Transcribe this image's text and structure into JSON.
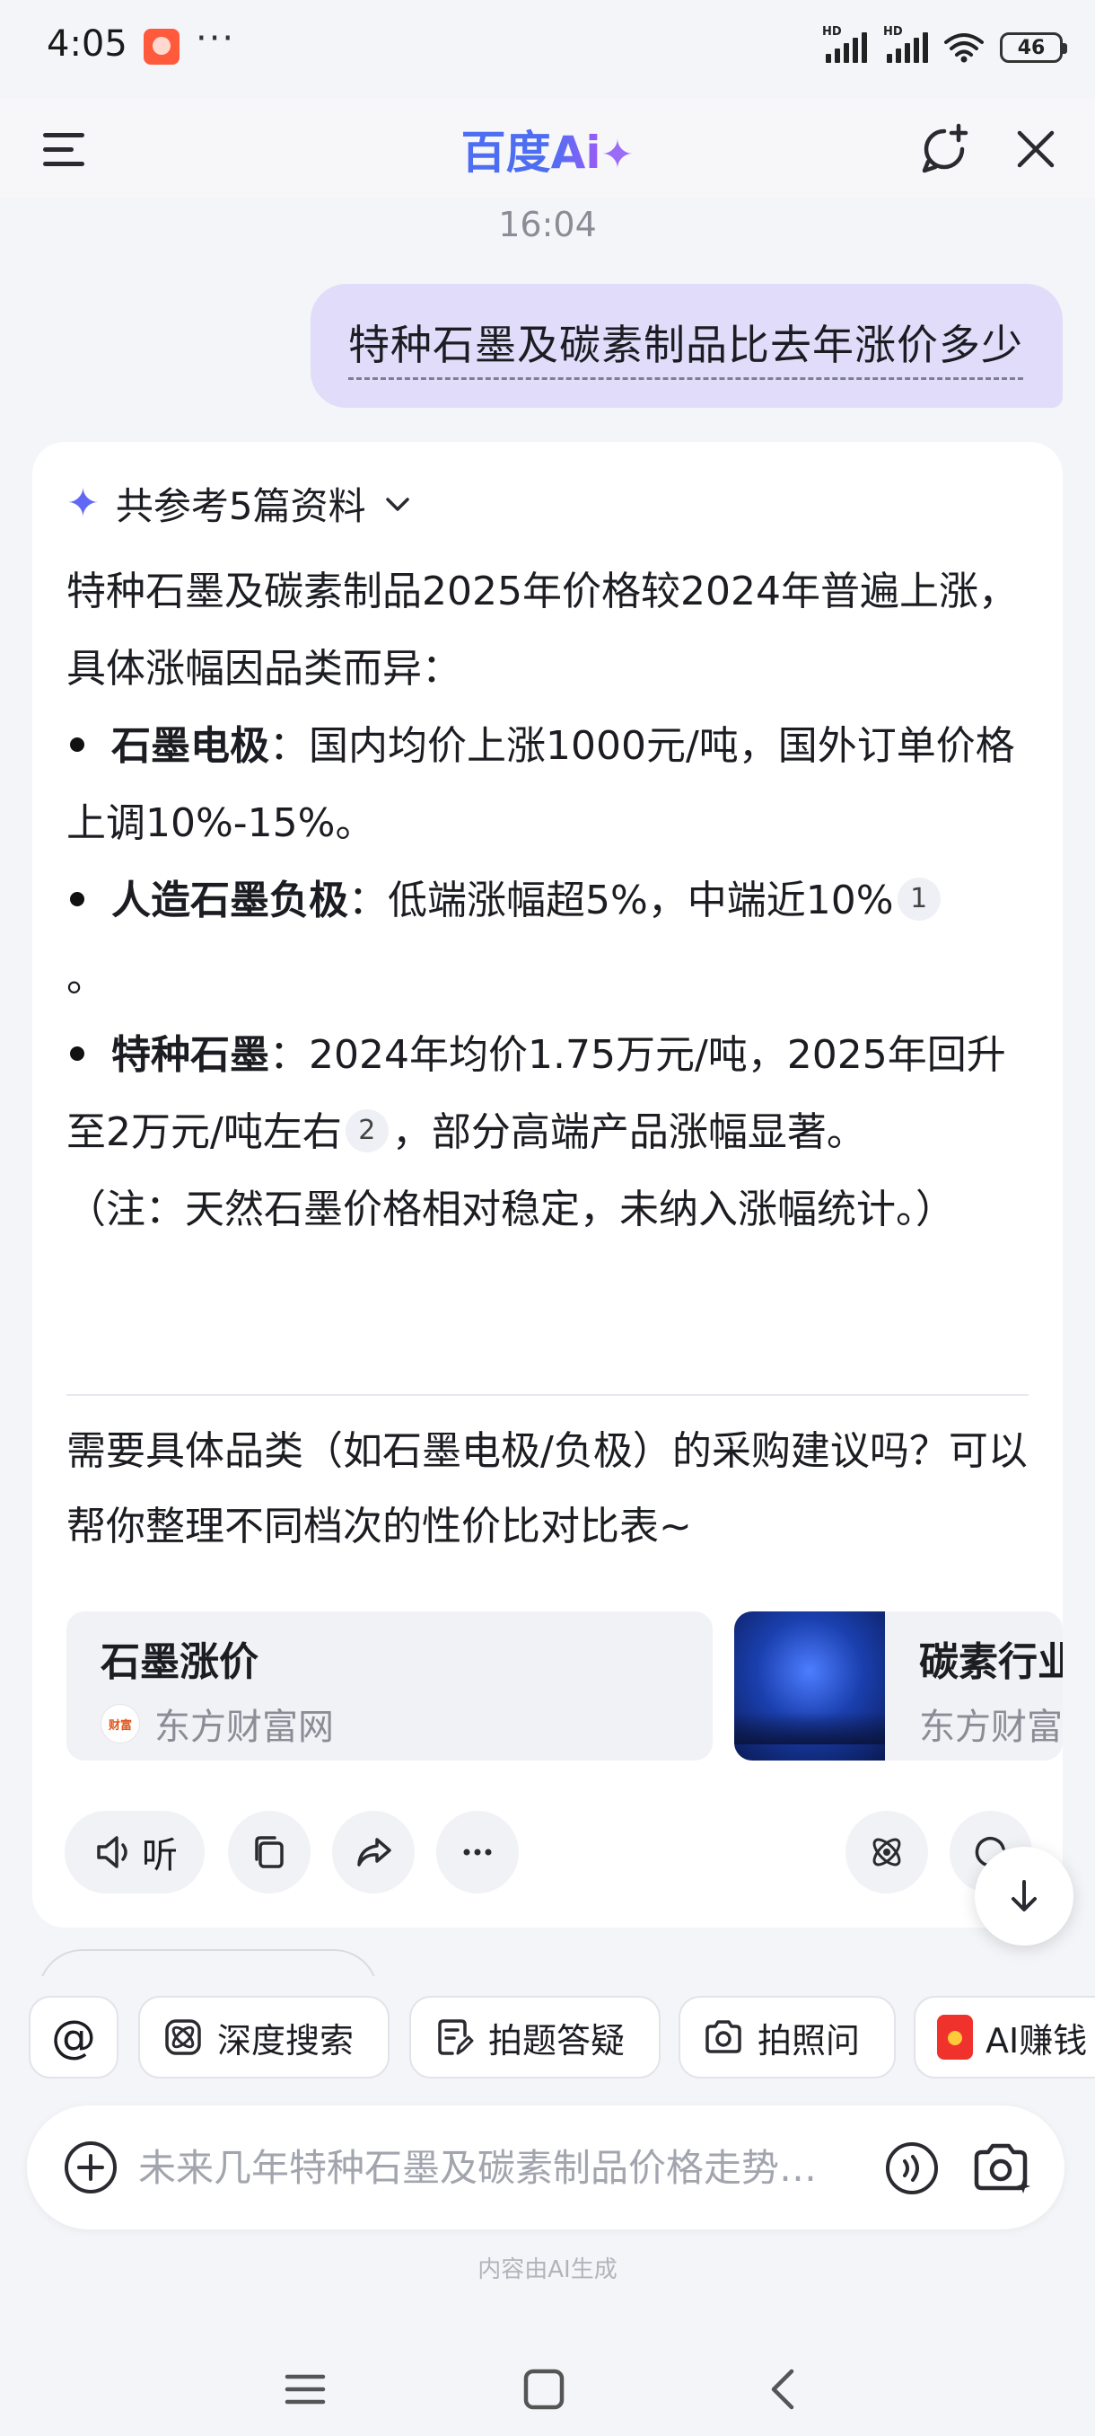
{
  "status_bar": {
    "time": "4:05",
    "more": "···",
    "battery": "46",
    "signal_tag": "HD"
  },
  "header": {
    "brand_main": "百度",
    "brand_ai": "Ai",
    "brand_spark": "✦"
  },
  "chat": {
    "timestamp": "16:04",
    "user_message": "特种石墨及碳素制品比去年涨价多少",
    "answer": {
      "references": "共参考5篇资料",
      "intro": "特种石墨及碳素制品2025年价格较2024年普遍上涨，具体涨幅因品类而异：",
      "bullets": [
        {
          "term": "石墨电极",
          "text": "：国内均价上涨1000元/吨，国外订单价格上调10%-15%。"
        },
        {
          "term": "人造石墨负极",
          "text": "：低端涨幅超5%，中端近10%",
          "cite": "1",
          "tail": "。"
        },
        {
          "term": "特种石墨",
          "text": "：2024年均价1.75万元/吨，2025年回升至2万元/吨左右",
          "cite": "2",
          "tail": "，部分高端产品涨幅显著。"
        }
      ],
      "note": "（注：天然石墨价格相对稳定，未纳入涨幅统计。）",
      "followup": "需要具体品类（如石墨电极/负极）的采购建议吗？可以帮你整理不同档次的性价比对比表~"
    },
    "sources": [
      {
        "title": "石墨涨价",
        "site": "东方财富网",
        "logo_text": "财富"
      },
      {
        "title": "碳素行业",
        "site": "东方财富网"
      }
    ],
    "actions": {
      "listen": "听"
    }
  },
  "quick_chips": {
    "at": "@",
    "deep_search": "深度搜索",
    "photo_question": "拍题答疑",
    "photo_ask": "拍照问",
    "ai_earn": "AI赚钱"
  },
  "composer": {
    "placeholder": "未来几年特种石墨及碳素制品价格走势…"
  },
  "disclaimer": "内容由AI生成",
  "colors": {
    "accent": "#4e6ef2",
    "user_bubble": "#e0dcfa",
    "background": "#f4f5f9"
  }
}
